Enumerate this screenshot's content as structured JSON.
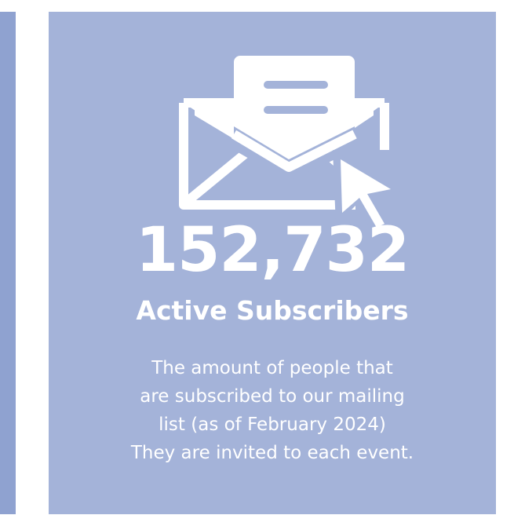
{
  "card": {
    "background": "#a4b3d9",
    "accent": "#8fa2d0",
    "icon": "envelope-with-cursor-icon",
    "stat_number": "152,732",
    "stat_label": "Active Subscribers",
    "description_lines": [
      "The amount of people that",
      "are subscribed to our mailing",
      "list (as of February 2024)",
      "They are invited to each event."
    ]
  }
}
